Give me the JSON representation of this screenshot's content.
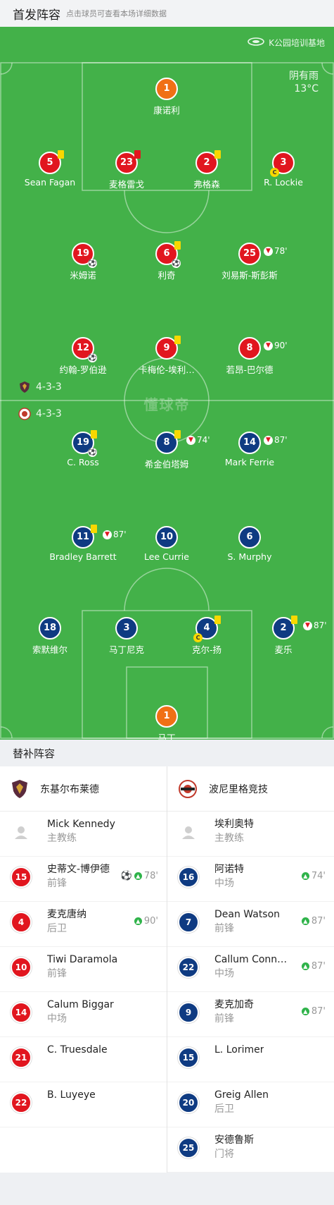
{
  "header": {
    "title": "首发阵容",
    "hint": "点击球员可查看本场详细数据"
  },
  "pitch": {
    "venue": "K公园培训基地",
    "weather": "阴有雨",
    "temperature": "13°C",
    "brand": "懂球帝",
    "home_formation": "4-3-3",
    "away_formation": "4-3-3"
  },
  "home_players": [
    {
      "num": "1",
      "name": "康诺利",
      "kit": "gk"
    },
    {
      "num": "5",
      "name": "Sean Fagan",
      "kit": "red",
      "card": "yellow"
    },
    {
      "num": "23",
      "name": "麦格雷戈",
      "kit": "red",
      "card": "red"
    },
    {
      "num": "2",
      "name": "弗格森",
      "kit": "red",
      "card": "yellow"
    },
    {
      "num": "3",
      "name": "R. Lockie",
      "kit": "red",
      "captain": true
    },
    {
      "num": "19",
      "name": "米姆诺",
      "kit": "red",
      "goal": true
    },
    {
      "num": "6",
      "name": "利奇",
      "kit": "red",
      "card": "yellow",
      "goal": true
    },
    {
      "num": "25",
      "name": "刘易斯-斯彭斯",
      "kit": "red",
      "sub_min": "78'"
    },
    {
      "num": "12",
      "name": "约翰-罗伯逊",
      "kit": "red",
      "goal": true
    },
    {
      "num": "9",
      "name": "卡梅伦-埃利…",
      "kit": "red",
      "card": "yellow"
    },
    {
      "num": "8",
      "name": "若昂-巴尔德",
      "kit": "red",
      "sub_min": "90'"
    }
  ],
  "away_players": [
    {
      "num": "19",
      "name": "C. Ross",
      "kit": "blue",
      "card": "yellow",
      "goal": true
    },
    {
      "num": "8",
      "name": "希金伯塔姆",
      "kit": "blue",
      "card": "yellow",
      "sub_min": "74'"
    },
    {
      "num": "14",
      "name": "Mark Ferrie",
      "kit": "blue",
      "sub_min": "87'"
    },
    {
      "num": "11",
      "name": "Bradley Barrett",
      "kit": "blue",
      "card": "yellow",
      "sub_min": "87'"
    },
    {
      "num": "10",
      "name": "Lee Currie",
      "kit": "blue"
    },
    {
      "num": "6",
      "name": "S. Murphy",
      "kit": "blue"
    },
    {
      "num": "18",
      "name": "索默维尔",
      "kit": "blue"
    },
    {
      "num": "3",
      "name": "马丁尼克",
      "kit": "blue"
    },
    {
      "num": "4",
      "name": "克尔-扬",
      "kit": "blue",
      "card": "yellow",
      "captain": true
    },
    {
      "num": "2",
      "name": "麦乐",
      "kit": "blue",
      "card": "yellow",
      "sub_min": "87'"
    },
    {
      "num": "1",
      "name": "马丁",
      "kit": "gk"
    }
  ],
  "subs": {
    "title": "替补阵容",
    "home": {
      "team": "东基尔布莱德",
      "coach": {
        "name": "Mick Kennedy",
        "role": "主教练"
      },
      "players": [
        {
          "num": "15",
          "name": "史蒂文-博伊德",
          "pos": "前锋",
          "goal": true,
          "minute": "78'"
        },
        {
          "num": "4",
          "name": "麦克唐纳",
          "pos": "后卫",
          "minute": "90'"
        },
        {
          "num": "10",
          "name": "Tiwi Daramola",
          "pos": "前锋"
        },
        {
          "num": "14",
          "name": "Calum Biggar",
          "pos": "中场"
        },
        {
          "num": "21",
          "name": "C. Truesdale",
          "pos": ""
        },
        {
          "num": "22",
          "name": "B. Luyeye",
          "pos": ""
        }
      ]
    },
    "away": {
      "team": "波尼里格竞技",
      "coach": {
        "name": "埃利奥特",
        "role": "主教练"
      },
      "players": [
        {
          "num": "16",
          "name": "阿诺特",
          "pos": "中场",
          "minute": "74'"
        },
        {
          "num": "7",
          "name": "Dean Watson",
          "pos": "前锋",
          "minute": "87'"
        },
        {
          "num": "22",
          "name": "Callum Conn…",
          "pos": "中场",
          "minute": "87'"
        },
        {
          "num": "9",
          "name": "麦克加奇",
          "pos": "前锋",
          "minute": "87'"
        },
        {
          "num": "15",
          "name": "L. Lorimer",
          "pos": ""
        },
        {
          "num": "20",
          "name": "Greig Allen",
          "pos": "后卫"
        },
        {
          "num": "25",
          "name": "安德鲁斯",
          "pos": "门将"
        }
      ]
    }
  },
  "colors": {
    "pitch": "#43b149",
    "home_kit": "#e1161f",
    "away_kit": "#0f3b82",
    "gk_kit": "#f07015",
    "yellow_card": "#f8d800",
    "sub_in": "#2fb34a"
  }
}
